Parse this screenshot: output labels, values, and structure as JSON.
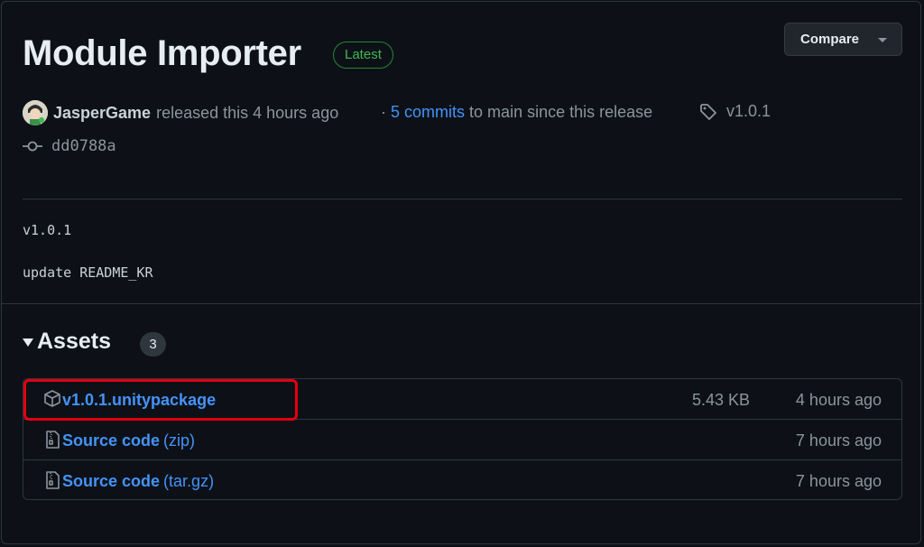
{
  "release": {
    "title": "Module Importer",
    "badge": "Latest",
    "compare_label": "Compare",
    "author": "JasperGame",
    "released_text": "released this 4 hours ago",
    "commits_prefix": "·",
    "commits_link": "5 commits",
    "commits_suffix": "to main since this release",
    "tag": "v1.0.1",
    "commit_hash": "dd0788a",
    "notes": [
      "v1.0.1",
      "update README_KR"
    ]
  },
  "assets": {
    "heading": "Assets",
    "count": "3",
    "items": [
      {
        "name": "v1.0.1.unitypackage",
        "sub": "",
        "size": "5.43 KB",
        "time": "4 hours ago",
        "icon": "package-icon"
      },
      {
        "name": "Source code",
        "sub": "(zip)",
        "size": "",
        "time": "7 hours ago",
        "icon": "file-zip-icon"
      },
      {
        "name": "Source code",
        "sub": "(tar.gz)",
        "size": "",
        "time": "7 hours ago",
        "icon": "file-zip-icon"
      }
    ]
  },
  "colors": {
    "background": "#0d1117",
    "link": "#4493f8",
    "badge_green": "#3fb950",
    "highlight_red": "#e3000f"
  }
}
